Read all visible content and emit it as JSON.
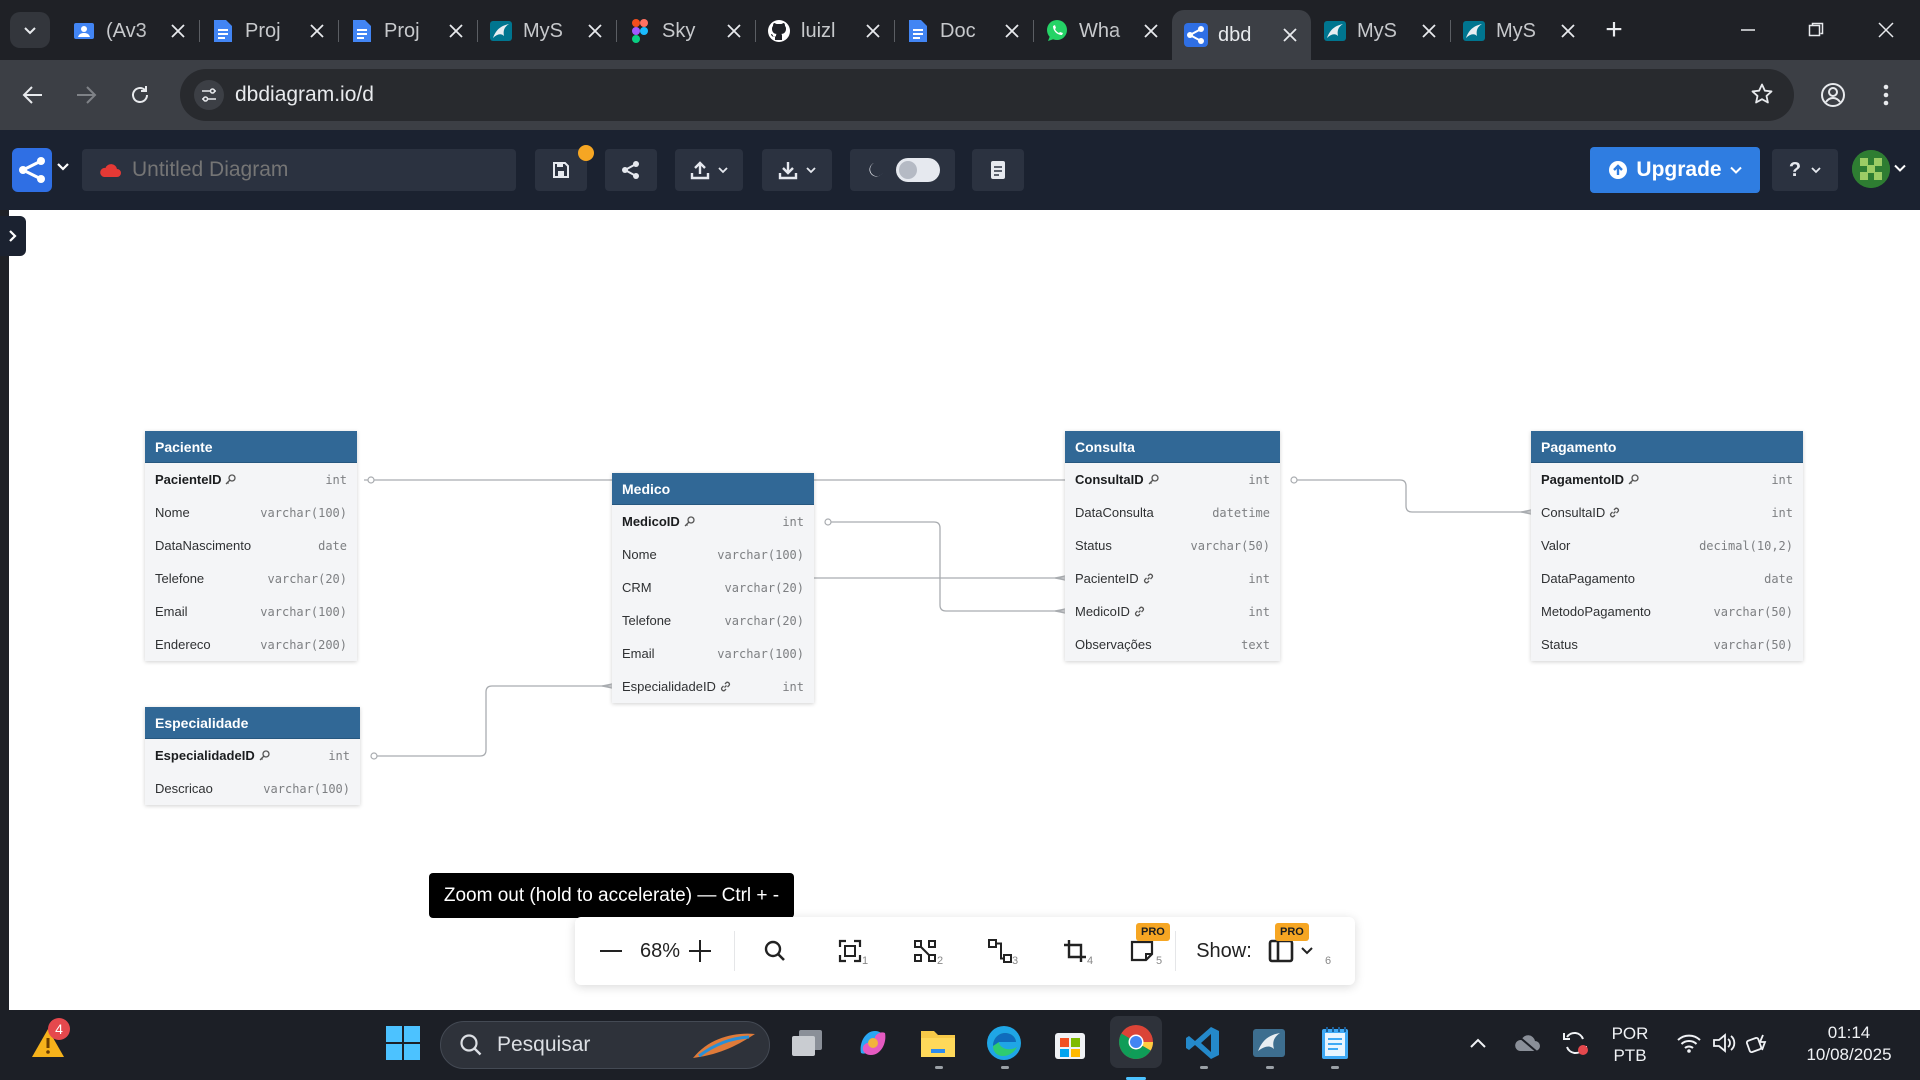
{
  "browser": {
    "tabs": [
      {
        "title": "(Av3",
        "icon": "classroom-icon",
        "color": "#4285f4",
        "active": false
      },
      {
        "title": "Proj",
        "icon": "google-docs-icon",
        "color": "#4285f4",
        "active": false
      },
      {
        "title": "Proj",
        "icon": "google-docs-icon",
        "color": "#4285f4",
        "active": false
      },
      {
        "title": "MyS",
        "icon": "mysql-icon",
        "color": "#00758f",
        "active": false
      },
      {
        "title": "Sky",
        "icon": "figma-icon",
        "color": "#a259ff",
        "active": false
      },
      {
        "title": "luizl",
        "icon": "github-icon",
        "color": "#ffffff",
        "active": false
      },
      {
        "title": "Doc",
        "icon": "google-docs-icon",
        "color": "#4285f4",
        "active": false
      },
      {
        "title": "Wha",
        "icon": "whatsapp-icon",
        "color": "#25d366",
        "active": false
      },
      {
        "title": "dbd",
        "icon": "dbdiagram-icon",
        "color": "#2f6fe4",
        "active": true
      },
      {
        "title": "MyS",
        "icon": "mysql-icon",
        "color": "#00758f",
        "active": false
      },
      {
        "title": "MyS",
        "icon": "mysql-icon",
        "color": "#00758f",
        "active": false
      }
    ],
    "url": "dbdiagram.io/d"
  },
  "app": {
    "diagram_title_placeholder": "Untitled Diagram",
    "upgrade_label": "Upgrade",
    "help_label": "?",
    "accent": "#2f7de1",
    "header_bg": "#1b2230"
  },
  "diagram": {
    "tables": [
      {
        "name": "Paciente",
        "fields": [
          {
            "name": "PacienteID",
            "type": "int",
            "pk": true,
            "fk": false
          },
          {
            "name": "Nome",
            "type": "varchar(100)",
            "pk": false,
            "fk": false
          },
          {
            "name": "DataNascimento",
            "type": "date",
            "pk": false,
            "fk": false
          },
          {
            "name": "Telefone",
            "type": "varchar(20)",
            "pk": false,
            "fk": false
          },
          {
            "name": "Email",
            "type": "varchar(100)",
            "pk": false,
            "fk": false
          },
          {
            "name": "Endereco",
            "type": "varchar(200)",
            "pk": false,
            "fk": false
          }
        ]
      },
      {
        "name": "Medico",
        "fields": [
          {
            "name": "MedicoID",
            "type": "int",
            "pk": true,
            "fk": false
          },
          {
            "name": "Nome",
            "type": "varchar(100)",
            "pk": false,
            "fk": false
          },
          {
            "name": "CRM",
            "type": "varchar(20)",
            "pk": false,
            "fk": false
          },
          {
            "name": "Telefone",
            "type": "varchar(20)",
            "pk": false,
            "fk": false
          },
          {
            "name": "Email",
            "type": "varchar(100)",
            "pk": false,
            "fk": false
          },
          {
            "name": "EspecialidadeID",
            "type": "int",
            "pk": false,
            "fk": true
          }
        ]
      },
      {
        "name": "Consulta",
        "fields": [
          {
            "name": "ConsultaID",
            "type": "int",
            "pk": true,
            "fk": false
          },
          {
            "name": "DataConsulta",
            "type": "datetime",
            "pk": false,
            "fk": false
          },
          {
            "name": "Status",
            "type": "varchar(50)",
            "pk": false,
            "fk": false
          },
          {
            "name": "PacienteID",
            "type": "int",
            "pk": false,
            "fk": true
          },
          {
            "name": "MedicoID",
            "type": "int",
            "pk": false,
            "fk": true
          },
          {
            "name": "Observações",
            "type": "text",
            "pk": false,
            "fk": false
          }
        ]
      },
      {
        "name": "Pagamento",
        "fields": [
          {
            "name": "PagamentoID",
            "type": "int",
            "pk": true,
            "fk": false
          },
          {
            "name": "ConsultaID",
            "type": "int",
            "pk": false,
            "fk": true
          },
          {
            "name": "Valor",
            "type": "decimal(10,2)",
            "pk": false,
            "fk": false
          },
          {
            "name": "DataPagamento",
            "type": "date",
            "pk": false,
            "fk": false
          },
          {
            "name": "MetodoPagamento",
            "type": "varchar(50)",
            "pk": false,
            "fk": false
          },
          {
            "name": "Status",
            "type": "varchar(50)",
            "pk": false,
            "fk": false
          }
        ]
      },
      {
        "name": "Especialidade",
        "fields": [
          {
            "name": "EspecialidadeID",
            "type": "int",
            "pk": true,
            "fk": false
          },
          {
            "name": "Descricao",
            "type": "varchar(100)",
            "pk": false,
            "fk": false
          }
        ]
      }
    ],
    "header_color": "#316896"
  },
  "tooltip": "Zoom out (hold to accelerate) — Ctrl + -",
  "zoombar": {
    "zoom": "68%",
    "show_label": "Show:",
    "pro_badge": "PRO",
    "shortcuts": [
      "1",
      "2",
      "3",
      "4",
      "5",
      "6"
    ]
  },
  "taskbar": {
    "search_placeholder": "Pesquisar",
    "notification_count": "4",
    "lang_line1": "POR",
    "lang_line2": "PTB",
    "time": "01:14",
    "date": "10/08/2025"
  }
}
